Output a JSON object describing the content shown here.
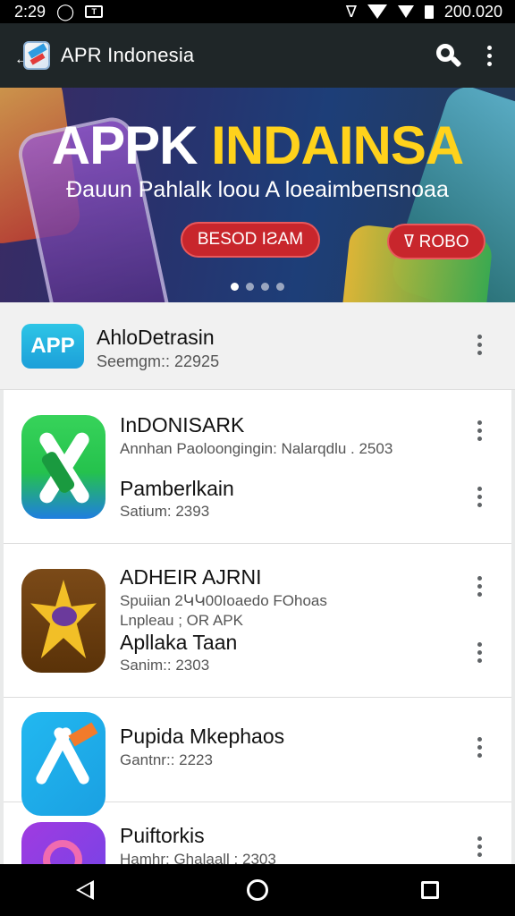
{
  "status_bar": {
    "time": "2:29",
    "right_text": "200.020"
  },
  "app_bar": {
    "title": "APR Indonesia"
  },
  "banner": {
    "title_part1": "APPK ",
    "title_part2": "INDAINSA",
    "subtitle": "Đauun Pahlalk loou A loeaimbeпsnoaa",
    "button_left": "BESOD IƧAM",
    "button_right": "ߜ ROBO",
    "active_dot": 0
  },
  "featured": {
    "icon_text": "APP",
    "title": "AhloDetrasin",
    "subtitle": "Seemgm:: 22925"
  },
  "apps": [
    {
      "title": "InDONISARK",
      "subtitle": "Annhan Paoloongingin: Nalarqdlu . 2503",
      "title2": "Pamberlkain",
      "subtitle2": "Satium: 2393"
    },
    {
      "title": "ADHEIR AJRNI",
      "subtitle": "Spuiian 2ԿԿ00Ioaedo FOhoas",
      "subtitle_b": "Lnpleau ; OR APK",
      "title2": "Apllaka Taan",
      "subtitle2": "Sanim:: 2303"
    },
    {
      "title": "Pupida Mkephaos",
      "subtitle": "Gantnr:: 2223"
    },
    {
      "title": "Puiftorkis",
      "subtitle": "Hamhr: Ghalaall : 2303"
    }
  ],
  "colors": {
    "app_bar": "#1f2628",
    "banner_title_accent": "#ffd21c",
    "banner_button": "#c8262c"
  },
  "icons": [
    "search-icon",
    "more-vert-icon",
    "back-icon",
    "home-icon",
    "recents-icon"
  ]
}
